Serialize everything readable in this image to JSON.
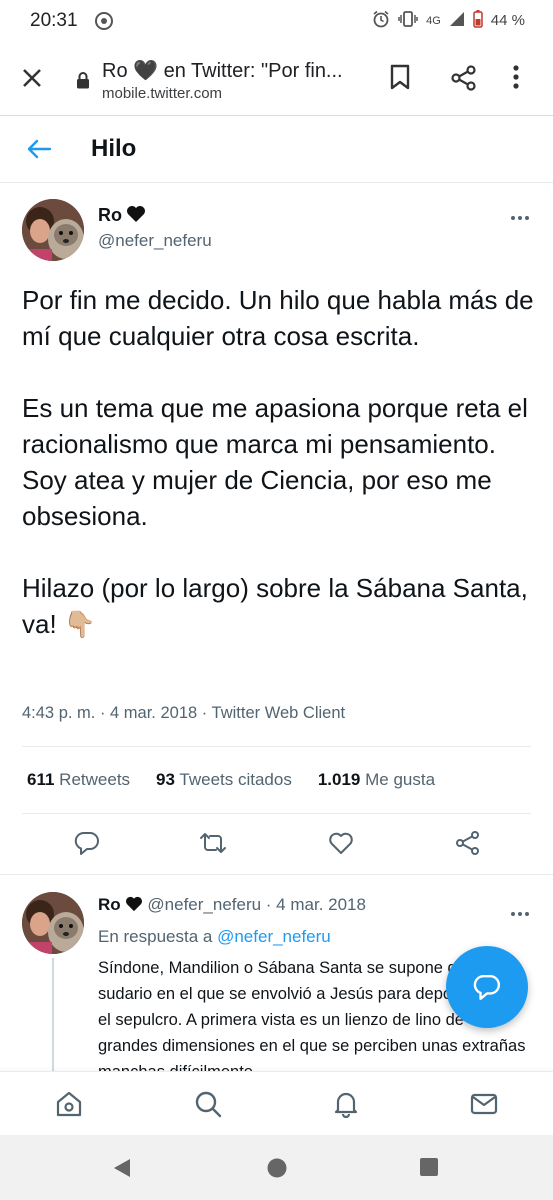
{
  "status_bar": {
    "time": "20:31",
    "network": "4G",
    "battery": "44 %"
  },
  "toolbar": {
    "title": "Ro 🖤 en Twitter: \"Por fin...",
    "url": "mobile.twitter.com"
  },
  "page_header": {
    "title": "Hilo"
  },
  "tweet": {
    "name": "Ro",
    "handle": "@nefer_neferu",
    "paragraphs": [
      "Por fin me decido. Un hilo que habla más de mí que cualquier otra cosa escrita.",
      "Es un tema que me apasiona porque reta el racionalismo que marca mi pensamiento. Soy atea y mujer de Ciencia, por eso me obsesiona.",
      "Hilazo (por lo largo) sobre la Sábana Santa, va! 👇🏼"
    ],
    "meta": "4:43 p. m. · 4 mar. 2018 · Twitter Web Client",
    "stats": {
      "retweets_count": "611",
      "retweets_label": "Retweets",
      "quotes_count": "93",
      "quotes_label": "Tweets citados",
      "likes_count": "1.019",
      "likes_label": "Me gusta"
    }
  },
  "reply": {
    "name": "Ro",
    "handle_date": "@nefer_neferu · 4 mar. 2018",
    "reply_prefix": "En respuesta a",
    "reply_to": "@nefer_neferu",
    "text": "Síndone, Mandilion o Sábana Santa se supone que es el sudario en el que se envolvió a Jesús para depositarlo en el sepulcro. A primera vista es un lienzo de lino de grandes dimensiones en el que se perciben unas extrañas manchas difícilmente"
  },
  "colors": {
    "accent": "#1d9bf0",
    "text": "#0f1419",
    "secondary": "#536471"
  },
  "icons": {
    "toolbar": [
      "close-icon",
      "lock-icon",
      "bookmark-icon",
      "share-icon",
      "more-vert-icon"
    ],
    "actions": [
      "reply-icon",
      "retweet-icon",
      "like-icon",
      "share-icon"
    ],
    "bottom_nav": [
      "home-icon",
      "search-icon",
      "notifications-icon",
      "messages-icon"
    ],
    "system_nav": [
      "back-triangle-icon",
      "home-circle-icon",
      "recents-square-icon"
    ]
  }
}
